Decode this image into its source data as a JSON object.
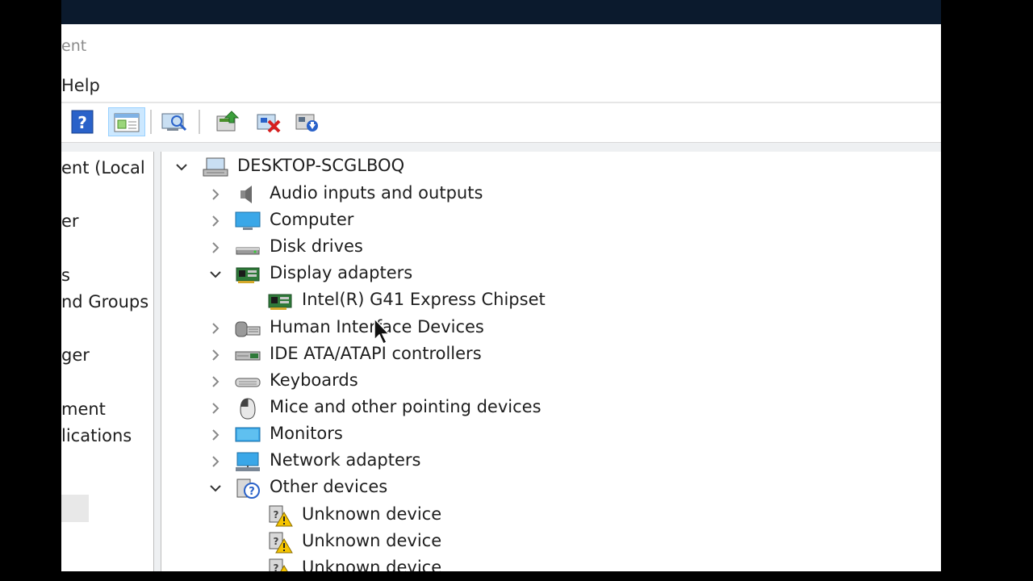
{
  "window": {
    "title_fragment": "ent",
    "menu": {
      "help_label": "Help"
    }
  },
  "toolbar": {
    "buttons": [
      {
        "icon": "help-icon"
      },
      {
        "icon": "properties-view-icon",
        "active": true
      },
      {
        "icon": "scan-hardware-icon"
      },
      {
        "icon": "update-driver-icon"
      },
      {
        "icon": "uninstall-device-icon"
      },
      {
        "icon": "add-legacy-hardware-icon"
      }
    ]
  },
  "left_pane": {
    "items": [
      {
        "label": "ent (Local"
      },
      {
        "label": "er"
      },
      {
        "label": "s"
      },
      {
        "label": "nd Groups"
      },
      {
        "label": "ger",
        "selected": true
      },
      {
        "label": "ment"
      },
      {
        "label": "lications"
      }
    ]
  },
  "tree": {
    "root": {
      "label": "DESKTOP-SCGLBOQ",
      "icon": "computer-root-icon",
      "expanded": true
    },
    "nodes": [
      {
        "label": "Audio inputs and outputs",
        "icon": "speaker-icon",
        "expanded": false,
        "level": 1
      },
      {
        "label": "Computer",
        "icon": "monitor-icon",
        "expanded": false,
        "level": 1
      },
      {
        "label": "Disk drives",
        "icon": "disk-drive-icon",
        "expanded": false,
        "level": 1
      },
      {
        "label": "Display adapters",
        "icon": "display-adapter-icon",
        "expanded": true,
        "level": 1
      },
      {
        "label": "Intel(R) G41 Express Chipset",
        "icon": "display-adapter-icon",
        "level": 2
      },
      {
        "label": "Human Interface Devices",
        "icon": "hid-icon",
        "expanded": false,
        "level": 1
      },
      {
        "label": "IDE ATA/ATAPI controllers",
        "icon": "ide-controller-icon",
        "expanded": false,
        "level": 1
      },
      {
        "label": "Keyboards",
        "icon": "keyboard-icon",
        "expanded": false,
        "level": 1
      },
      {
        "label": "Mice and other pointing devices",
        "icon": "mouse-icon",
        "expanded": false,
        "level": 1
      },
      {
        "label": "Monitors",
        "icon": "monitor-icon",
        "expanded": false,
        "level": 1
      },
      {
        "label": "Network adapters",
        "icon": "network-adapter-icon",
        "expanded": false,
        "level": 1
      },
      {
        "label": "Other devices",
        "icon": "other-devices-icon",
        "expanded": true,
        "level": 1
      },
      {
        "label": "Unknown device",
        "icon": "unknown-device-warning-icon",
        "level": 2
      },
      {
        "label": "Unknown device",
        "icon": "unknown-device-warning-icon",
        "level": 2
      },
      {
        "label": "Unknown device",
        "icon": "unknown-device-warning-icon",
        "level": 2
      }
    ]
  },
  "colors": {
    "selection_bg": "#cce8ff",
    "warning_yellow": "#f5c400",
    "top_strip": "#0b1a2d"
  }
}
